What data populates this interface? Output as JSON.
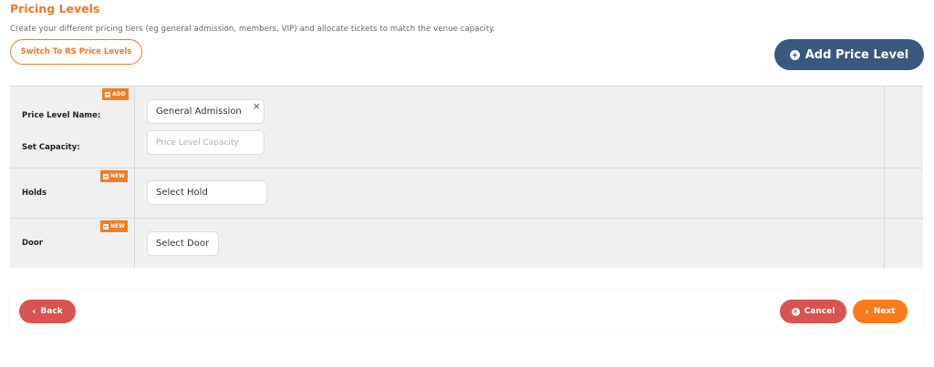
{
  "header": {
    "title": "Pricing Levels",
    "subtitle": "Create your different pricing tiers (eg general admission, members, VIP) and allocate tickets to match the venue capacity.",
    "switch_label": "Switch To RS Price Levels",
    "add_level_label": "Add Price Level"
  },
  "rows": {
    "price_level": {
      "badge": "ADD",
      "name_label": "Price Level Name:",
      "name_value": "General Admission",
      "clear_glyph": "×",
      "capacity_label": "Set Capacity:",
      "capacity_placeholder": "Price Level Capacity"
    },
    "holds": {
      "badge": "NEW",
      "label": "Holds",
      "value": "Select Hold"
    },
    "door": {
      "badge": "NEW",
      "label": "Door",
      "value": "Select Door"
    }
  },
  "footer": {
    "back_label": "Back",
    "back_icon": "‹",
    "cancel_label": "Cancel",
    "cancel_icon": "×",
    "next_label": "Next",
    "next_icon": "›"
  },
  "colors": {
    "accent": "#f0772e",
    "primary_button": "#3a577d",
    "danger": "#d9534f",
    "next": "#fb7a1a"
  }
}
